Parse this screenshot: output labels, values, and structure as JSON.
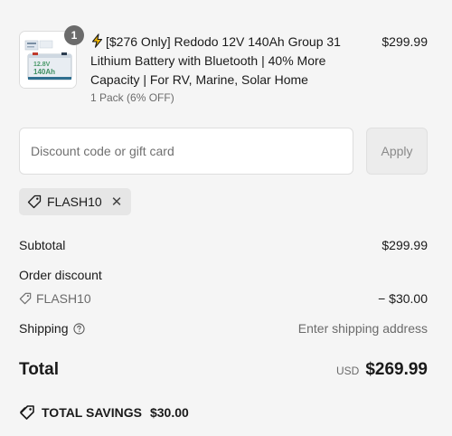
{
  "cart": {
    "item": {
      "quantity": "1",
      "title": "[$276 Only] Redodo 12V 140Ah Group 31 Lithium Battery with Bluetooth | 40% More Capacity | For RV, Marine, Solar Home",
      "variant": "1 Pack (6% OFF)",
      "price": "$299.99",
      "thumb_text": "12.8V 140Ah"
    }
  },
  "discount": {
    "placeholder": "Discount code or gift card",
    "value": "",
    "apply_label": "Apply",
    "applied_code": "FLASH10"
  },
  "summary": {
    "subtotal_label": "Subtotal",
    "subtotal_value": "$299.99",
    "order_discount_label": "Order discount",
    "order_discount_code": "FLASH10",
    "order_discount_value": "− $30.00",
    "shipping_label": "Shipping",
    "shipping_value": "Enter shipping address",
    "total_label": "Total",
    "currency": "USD",
    "total_value": "$269.99",
    "savings_label": "TOTAL SAVINGS",
    "savings_value": "$30.00"
  },
  "colors": {
    "background": "#f5f5f5",
    "badge": "#6b6b6b",
    "chip": "#e6e6e6",
    "muted_text": "#6b6b6b",
    "bolt": "#f2b705"
  },
  "icons": [
    "lightning-icon",
    "tag-icon",
    "close-icon",
    "help-circle-icon",
    "savings-tag-icon"
  ]
}
